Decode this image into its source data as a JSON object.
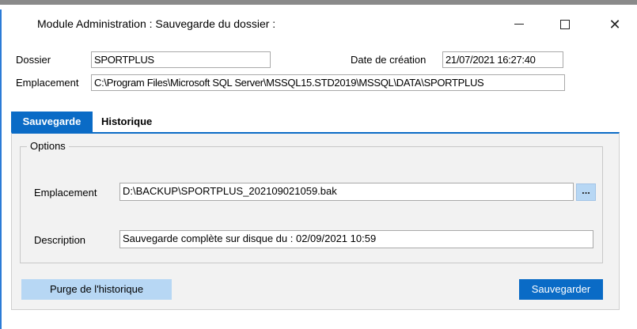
{
  "window": {
    "title": "Module Administration : Sauvegarde du dossier :",
    "controls": {
      "minimize": "—",
      "maximize": "☐",
      "close": "✕"
    }
  },
  "dossier": {
    "label": "Dossier",
    "value": "SPORTPLUS"
  },
  "date_creation": {
    "label": "Date de création",
    "value": "21/07/2021 16:27:40"
  },
  "emplacement_top": {
    "label": "Emplacement",
    "value": "C:\\Program Files\\Microsoft SQL Server\\MSSQL15.STD2019\\MSSQL\\DATA\\SPORTPLUS"
  },
  "tabs": [
    {
      "label": "Sauvegarde",
      "active": true
    },
    {
      "label": "Historique",
      "active": false
    }
  ],
  "options": {
    "legend": "Options",
    "emplacement_label": "Emplacement",
    "emplacement_value": "D:\\BACKUP\\SPORTPLUS_202109021059.bak",
    "browse_label": "...",
    "description_label": "Description",
    "description_value": "Sauvegarde complète sur disque  du : 02/09/2021 10:59"
  },
  "buttons": {
    "purge": "Purge de l'historique",
    "save": "Sauvegarder"
  },
  "colors": {
    "accent": "#0a6bc6",
    "light_button": "#b7d7f4",
    "panel_bg": "#f2f2f2"
  }
}
